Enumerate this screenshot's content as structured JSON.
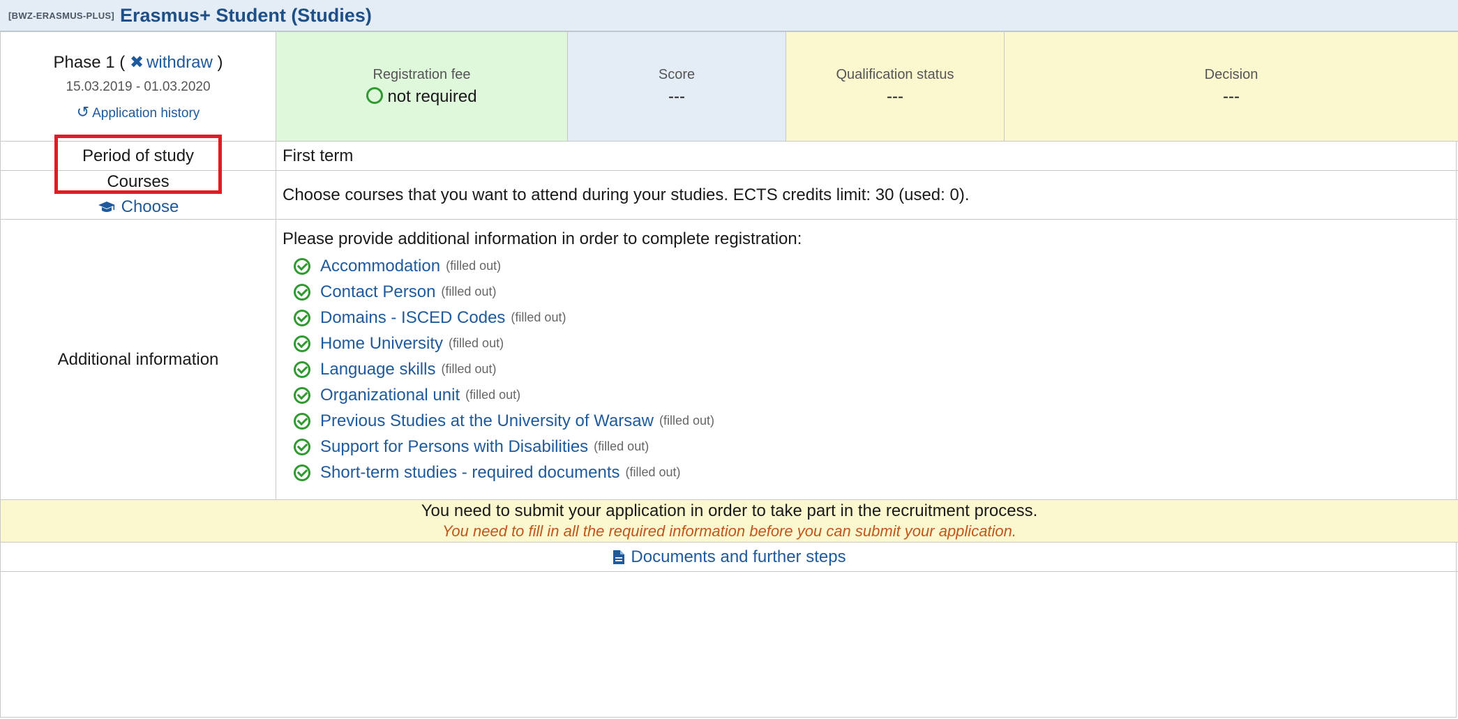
{
  "header": {
    "code": "[BWZ-ERASMUS-PLUS]",
    "title": "Erasmus+ Student (Studies)"
  },
  "phase": {
    "label": "Phase 1",
    "open_paren": "(",
    "close_paren": ")",
    "withdraw_icon": "close-icon",
    "withdraw_label": "withdraw",
    "dates": "15.03.2019 - 01.03.2020",
    "history_icon": "history-icon",
    "history_label": "Application history"
  },
  "status": {
    "fee_label": "Registration fee",
    "fee_value": "not required",
    "score_label": "Score",
    "score_value": "---",
    "qual_label": "Qualification status",
    "qual_value": "---",
    "decision_label": "Decision",
    "decision_value": "---"
  },
  "colors": {
    "fee_bg": "#dff7db",
    "score_bg": "#e4ecf5",
    "qual_bg": "#fbf8cf",
    "link": "#1e5a9c",
    "highlight": "#e01b24",
    "warning_text": "#c0561c"
  },
  "period": {
    "label": "Period of study",
    "value": "First term"
  },
  "courses": {
    "label": "Courses",
    "choose_icon": "graduation-cap-icon",
    "choose_label": "Choose",
    "description": "Choose courses that you want to attend during your studies. ECTS credits limit: 30 (used: 0)."
  },
  "additional": {
    "label": "Additional information",
    "intro": "Please provide additional information in order to complete registration:",
    "items": [
      {
        "name": "Accommodation",
        "state": "(filled out)"
      },
      {
        "name": "Contact Person",
        "state": "(filled out)"
      },
      {
        "name": "Domains - ISCED Codes",
        "state": "(filled out)"
      },
      {
        "name": "Home University",
        "state": "(filled out)"
      },
      {
        "name": "Language skills",
        "state": "(filled out)"
      },
      {
        "name": "Organizational unit",
        "state": "(filled out)"
      },
      {
        "name": "Previous Studies at the University of Warsaw",
        "state": "(filled out)"
      },
      {
        "name": "Support for Persons with Disabilities",
        "state": "(filled out)"
      },
      {
        "name": "Short-term studies - required documents",
        "state": "(filled out)"
      }
    ]
  },
  "notice": {
    "line1": "You need to submit your application in order to take part in the recruitment process.",
    "line2": "You need to fill in all the required information before you can submit your application."
  },
  "documents": {
    "icon": "document-icon",
    "label": "Documents and further steps"
  }
}
